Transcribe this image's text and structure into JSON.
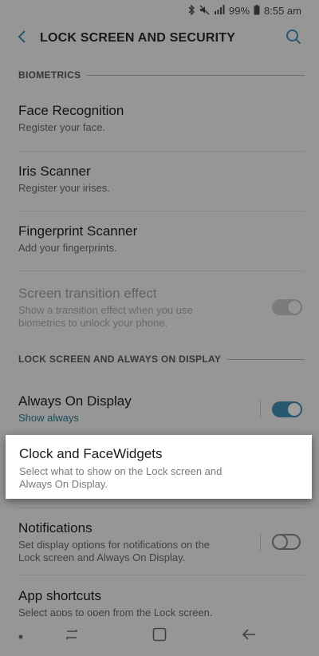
{
  "status_bar": {
    "battery": "99%",
    "time": "8:55 am",
    "icons": [
      "bluetooth-icon",
      "mute-icon",
      "signal-icon",
      "battery-icon"
    ]
  },
  "app_bar": {
    "title": "LOCK SCREEN AND SECURITY",
    "icons": [
      "back-arrow-icon",
      "search-icon"
    ]
  },
  "sections": {
    "biometrics": {
      "header": "BIOMETRICS"
    },
    "lock_screen": {
      "header": "LOCK SCREEN AND ALWAYS ON DISPLAY"
    }
  },
  "items": {
    "face_recognition": {
      "title": "Face Recognition",
      "subtitle": "Register your face."
    },
    "iris_scanner": {
      "title": "Iris Scanner",
      "subtitle": "Register your irises."
    },
    "fingerprint_scanner": {
      "title": "Fingerprint Scanner",
      "subtitle": "Add your fingerprints."
    },
    "screen_transition": {
      "title": "Screen transition effect",
      "subtitle_line1": "Show a transition effect when you use",
      "subtitle_line2": "biometrics to unlock your phone.",
      "switch": "on",
      "enabled": false
    },
    "always_on_display": {
      "title": "Always On Display",
      "subtitle": "Show always",
      "switch": "on"
    },
    "clock_facewidgets": {
      "title": "Clock and FaceWidgets",
      "subtitle_line1": "Select what to show on the Lock screen and",
      "subtitle_line2": "Always On Display."
    },
    "notifications": {
      "title": "Notifications",
      "subtitle_line1": "Set display options for notifications on the",
      "subtitle_line2": "Lock screen and Always On Display.",
      "switch": "off"
    },
    "app_shortcuts": {
      "title": "App shortcuts",
      "subtitle": "Select apps to open from the Lock screen."
    }
  },
  "nav_bar": {
    "icons": [
      "dot-icon",
      "recents-icon",
      "home-icon",
      "back-icon"
    ]
  },
  "colors": {
    "accent": "#3f8fb0",
    "background": "#f2f2f2",
    "dim_overlay": "rgba(0,0,0,0.38)"
  }
}
